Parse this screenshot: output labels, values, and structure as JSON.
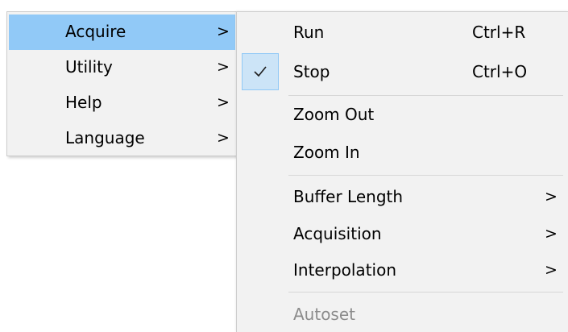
{
  "main_menu": {
    "items": [
      {
        "label": "Acquire",
        "arrow": ">"
      },
      {
        "label": "Utility",
        "arrow": ">"
      },
      {
        "label": "Help",
        "arrow": ">"
      },
      {
        "label": "Language",
        "arrow": ">"
      }
    ],
    "highlighted_item": "Acquire"
  },
  "sub_menu": {
    "run": {
      "label": "Run",
      "shortcut": "Ctrl+R"
    },
    "stop": {
      "label": "Stop",
      "shortcut": "Ctrl+O",
      "checked": true
    },
    "zoom_out": {
      "label": "Zoom Out"
    },
    "zoom_in": {
      "label": "Zoom In"
    },
    "buffer_length": {
      "label": "Buffer Length",
      "arrow": ">"
    },
    "acquisition": {
      "label": "Acquisition",
      "arrow": ">"
    },
    "interpolation": {
      "label": "Interpolation",
      "arrow": ">"
    },
    "autoset": {
      "label": "Autoset",
      "disabled": true
    }
  },
  "colors": {
    "menu_background": "#f2f2f2",
    "highlight": "#91c9f7",
    "check_background": "#cce4f7",
    "disabled_text": "#8c8c8c"
  }
}
